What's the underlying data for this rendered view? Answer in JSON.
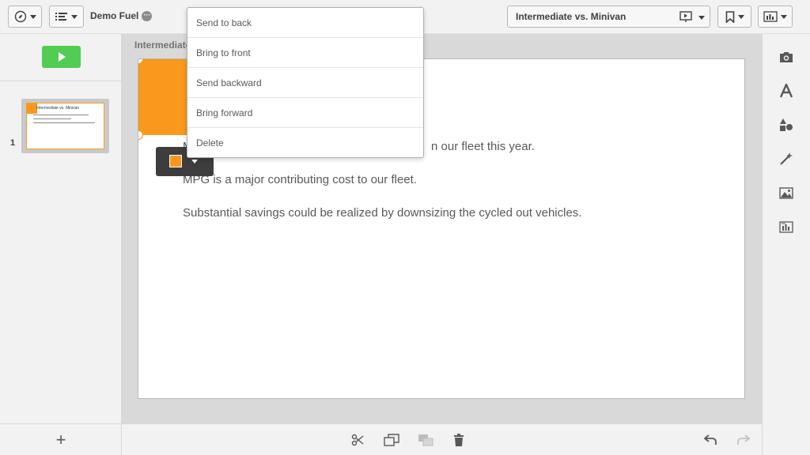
{
  "app": {
    "title": "Demo Fuel"
  },
  "story": {
    "selected": "Intermediate vs. Minivan"
  },
  "breadcrumb": "Intermediate vs. Minivan",
  "slides": [
    {
      "number": "1",
      "title": "Intermediate vs. Minivan"
    }
  ],
  "slide": {
    "lines": [
      "We will be cycling out older vehicles in our fleet this year.",
      "MPG is a major contributing cost to our fleet.",
      "Substantial savings could be realized by downsizing the cycled out vehicles."
    ],
    "visible_line_1_fragment": "n our fleet this year.",
    "visible_line_1_prefix": "M"
  },
  "context_menu": {
    "items": [
      "Send to back",
      "Bring to front",
      "Send backward",
      "Bring forward",
      "Delete"
    ]
  },
  "shape_toolbar": {
    "swatch_color": "#f8981d"
  },
  "colors": {
    "accent_orange": "#f8981d",
    "play_green": "#52cc52",
    "toolbar_bg": "#f2f2f2",
    "canvas_bg": "#d9d9d9"
  },
  "left_panel": {
    "add_label": "+"
  },
  "icons": {
    "top_left": [
      "compass-icon",
      "list-icon"
    ],
    "top_right": [
      "present-icon",
      "bookmark-icon",
      "sheet-icon"
    ],
    "bottom": [
      "cut-icon",
      "duplicate-icon",
      "layer-icon",
      "delete-icon",
      "undo-icon",
      "redo-icon"
    ],
    "right": [
      "snapshot-icon",
      "text-icon",
      "shapes-icon",
      "effects-icon",
      "image-icon",
      "sheet-library-icon"
    ]
  }
}
